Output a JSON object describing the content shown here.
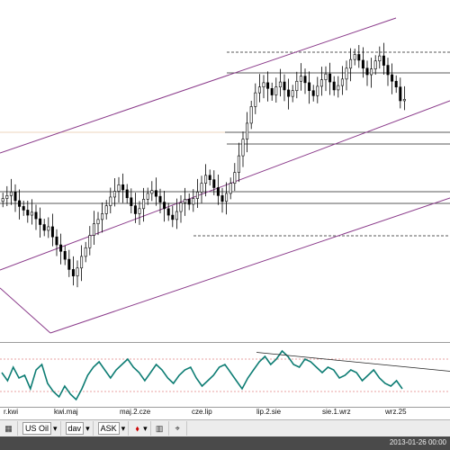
{
  "time_axis_labels": [
    "r.kwi",
    "kwi.maj",
    "maj.2.cze",
    "cze.lip",
    "lip.2.sie",
    "sie.1.wrz",
    "wrz.25"
  ],
  "toolbar": {
    "symbol": "US Oil",
    "interval": "dav",
    "price_type": "ASK",
    "marker_icon": "pin-icon",
    "grid_icon": "grid-icon",
    "cursor_icon": "crosshair-icon"
  },
  "status": {
    "timestamp": "2013-01-26 00:00"
  },
  "colors": {
    "candle": "#000000",
    "channel": "#8a3a8a",
    "oscillator": "#0e7d74",
    "osc_level": "#d44444",
    "status_bg": "#4a4a4a"
  },
  "chart_data": [
    {
      "type": "candlestick",
      "title": "",
      "series": [
        {
          "close": [
            59.2,
            59.6,
            60.1,
            58.9,
            58.1,
            57.6,
            56.9,
            57.3,
            56.4,
            55.6,
            54.8,
            55.3,
            53.9,
            52.8,
            51.9,
            50.8,
            49.4,
            48.5,
            49.6,
            51.2,
            52.4,
            54.1,
            55.7,
            56.3,
            57.1,
            58.2,
            59.4,
            60.2,
            61.1,
            60.4,
            59.3,
            58.2,
            57.1,
            57.8,
            59.1,
            59.9,
            60.3,
            59.5,
            58.7,
            57.8,
            56.9,
            56.3,
            57.4,
            58.6,
            59.1,
            58.4,
            59.2,
            60.1,
            61.3,
            62.4,
            61.8,
            60.7,
            59.6,
            58.8,
            59.9,
            61.3,
            62.8,
            65.1,
            67.4,
            69.6,
            71.9,
            73.8,
            74.6,
            75.2,
            74.4,
            73.5,
            74.6,
            75.3,
            74.2,
            73.3,
            74.1,
            75.4,
            76.1,
            75.2,
            74.1,
            73.4,
            74.7,
            75.6,
            76.4,
            75.3,
            74.2,
            74.8,
            75.7,
            77.2,
            78.4,
            79.1,
            78.3,
            77.2,
            76.3,
            77.1,
            78.2,
            78.9,
            77.6,
            76.3,
            75.4,
            74.6,
            72.7,
            72.9
          ]
        }
      ],
      "channels": [
        "upper-channel",
        "middle-channel",
        "lower-channel"
      ],
      "reference_lines": [
        "resistance-dashed-top",
        "resistance-solid",
        "support-solid",
        "mid-level-solid",
        "mid-level-solid-2",
        "support-dashed-bottom"
      ],
      "grid": false
    },
    {
      "type": "line",
      "title": "",
      "values": [
        0.1,
        -0.2,
        0.3,
        -0.1,
        0.0,
        -0.5,
        0.2,
        0.4,
        -0.3,
        -0.6,
        -0.8,
        -0.4,
        -0.7,
        -0.9,
        -0.5,
        0.0,
        0.3,
        0.5,
        0.2,
        -0.1,
        0.2,
        0.4,
        0.6,
        0.3,
        0.1,
        -0.2,
        0.1,
        0.4,
        0.2,
        -0.1,
        -0.3,
        0.0,
        0.2,
        0.3,
        -0.1,
        -0.4,
        -0.2,
        0.0,
        0.3,
        0.4,
        0.1,
        -0.2,
        -0.5,
        -0.1,
        0.2,
        0.5,
        0.7,
        0.4,
        0.6,
        0.9,
        0.7,
        0.4,
        0.3,
        0.6,
        0.5,
        0.3,
        0.1,
        0.3,
        0.2,
        -0.1,
        0.0,
        0.2,
        0.1,
        -0.2,
        0.0,
        0.2,
        -0.1,
        -0.3,
        -0.4,
        -0.2,
        -0.5
      ],
      "ylim": [
        -1,
        1
      ],
      "levels": [
        0.6,
        -0.6
      ],
      "grid": false
    }
  ]
}
